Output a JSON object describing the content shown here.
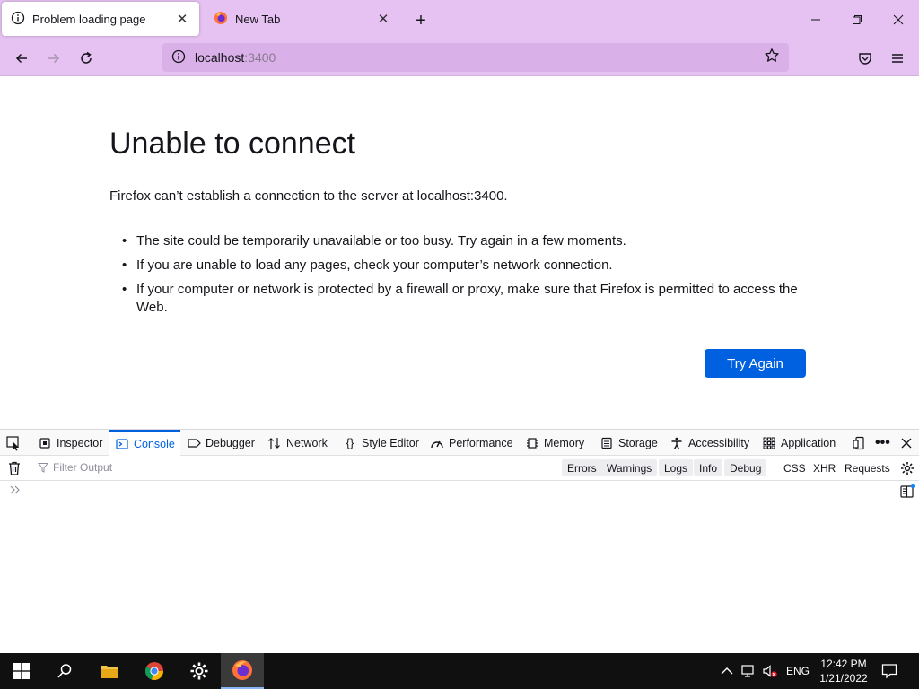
{
  "tabs": [
    {
      "label": "Problem loading page",
      "active": true
    },
    {
      "label": "New Tab",
      "active": false
    }
  ],
  "address": {
    "host": "localhost",
    "port": ":3400"
  },
  "error": {
    "title": "Unable to connect",
    "description": "Firefox can’t establish a connection to the server at localhost:3400.",
    "bullets": [
      "The site could be temporarily unavailable or too busy. Try again in a few moments.",
      "If you are unable to load any pages, check your computer’s network connection.",
      "If your computer or network is protected by a firewall or proxy, make sure that Firefox is permitted to access the Web."
    ],
    "retry_label": "Try Again"
  },
  "devtools": {
    "tabs": [
      "Inspector",
      "Console",
      "Debugger",
      "Network",
      "Style Editor",
      "Performance",
      "Memory",
      "Storage",
      "Accessibility",
      "Application"
    ],
    "selected_tab": "Console",
    "filter_placeholder": "Filter Output",
    "filters": [
      "Errors",
      "Warnings",
      "Logs",
      "Info",
      "Debug"
    ],
    "extra_filters": [
      "CSS",
      "XHR",
      "Requests"
    ]
  },
  "taskbar": {
    "language": "ENG",
    "time": "12:42 PM",
    "date": "1/21/2022"
  },
  "colors": {
    "chrome_bg": "#e5c2f1",
    "urlbar_bg": "#d9b0e8",
    "accent": "#0061e0",
    "taskbar_bg": "#101010"
  }
}
